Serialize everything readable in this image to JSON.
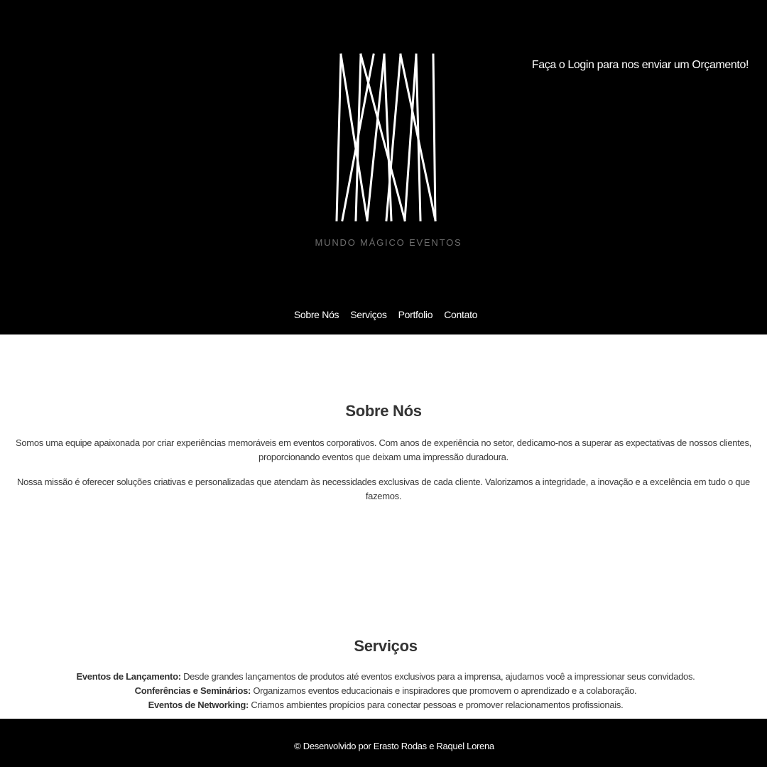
{
  "header": {
    "brand_name": "MUNDO MÁGICO EVENTOS",
    "logo_icon": "mm-monogram-logo",
    "login_cta": "Faça o Login para nos enviar um Orçamento!",
    "nav": [
      {
        "label": "Sobre Nós"
      },
      {
        "label": "Serviços"
      },
      {
        "label": "Portfolio"
      },
      {
        "label": "Contato"
      }
    ]
  },
  "about": {
    "title": "Sobre Nós",
    "paragraphs": [
      "Somos uma equipe apaixonada por criar experiências memoráveis em eventos corporativos. Com anos de experiência no setor, dedicamo-nos a superar as expectativas de nossos clientes, proporcionando eventos que deixam uma impressão duradoura.",
      "Nossa missão é oferecer soluções criativas e personalizadas que atendam às necessidades exclusivas de cada cliente. Valorizamos a integridade, a inovação e a excelência em tudo o que fazemos."
    ]
  },
  "services": {
    "title": "Serviços",
    "items": [
      {
        "name": "Eventos de Lançamento:",
        "description": " Desde grandes lançamentos de produtos até eventos exclusivos para a imprensa, ajudamos você a impressionar seus convidados."
      },
      {
        "name": "Conferências e Seminários:",
        "description": " Organizamos eventos educacionais e inspiradores que promovem o aprendizado e a colaboração."
      },
      {
        "name": "Eventos de Networking:",
        "description": " Criamos ambientes propícios para conectar pessoas e promover relacionamentos profissionais."
      }
    ]
  },
  "footer": {
    "credits": "© Desenvolvido por Erasto Rodas e Raquel Lorena"
  },
  "colors": {
    "header_bg": "#000000",
    "footer_bg": "#000000",
    "page_bg": "#ffffff",
    "heading_text": "#333333",
    "brand_text": "#6e6e6e"
  }
}
